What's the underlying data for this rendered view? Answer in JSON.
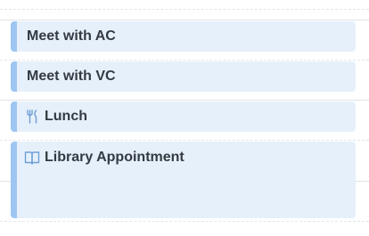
{
  "events": [
    {
      "title": "Meet with AC",
      "icon": null
    },
    {
      "title": "Meet with VC",
      "icon": null
    },
    {
      "title": "Lunch",
      "icon": "fork-knife-icon"
    },
    {
      "title": "Library Appointment",
      "icon": "book-icon"
    }
  ],
  "colors": {
    "event_background": "#e6f0fb",
    "event_accent": "#9ec6f3",
    "event_text": "#333a42",
    "icon_stroke": "#6f9fd6"
  }
}
